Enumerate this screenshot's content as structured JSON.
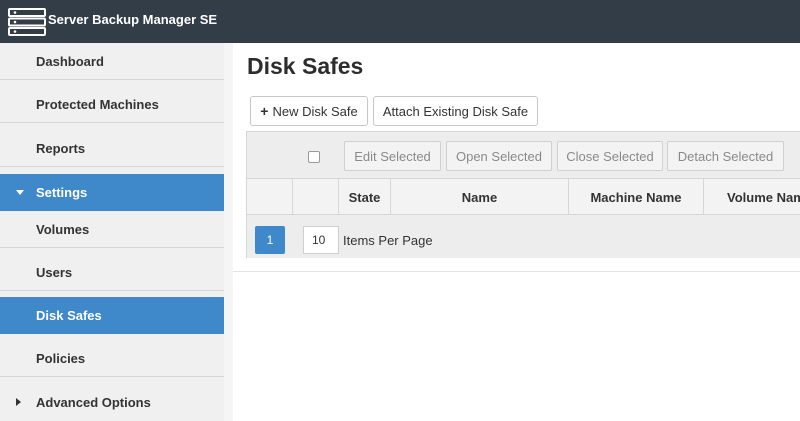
{
  "app": {
    "title": "Server Backup Manager SE",
    "logo_icon": "server-stack-icon"
  },
  "sidebar": {
    "items": [
      {
        "label": "Dashboard",
        "active": false
      },
      {
        "label": "Protected Machines",
        "active": false
      },
      {
        "label": "Reports",
        "active": false
      },
      {
        "label": "Settings",
        "active": true,
        "expanded": true
      },
      {
        "label": "Volumes",
        "active": false
      },
      {
        "label": "Users",
        "active": false
      },
      {
        "label": "Disk Safes",
        "active": true
      },
      {
        "label": "Policies",
        "active": false
      },
      {
        "label": "Advanced Options",
        "active": false,
        "expanded": false
      }
    ]
  },
  "main": {
    "title": "Disk Safes",
    "new_button": "New Disk Safe",
    "attach_button": "Attach Existing Disk Safe"
  },
  "grid": {
    "toolbar": {
      "edit": "Edit Selected",
      "open": "Open Selected",
      "close": "Close Selected",
      "detach": "Detach Selected"
    },
    "columns": [
      "State",
      "Name",
      "Machine Name",
      "Volume Name"
    ],
    "pager": {
      "current_page": "1",
      "items_per_page": "10",
      "items_per_page_label": "Items Per Page"
    }
  },
  "colors": {
    "topbar": "#333d47",
    "accent": "#3f88c9",
    "sidebar_bg": "#f0f0f0"
  }
}
